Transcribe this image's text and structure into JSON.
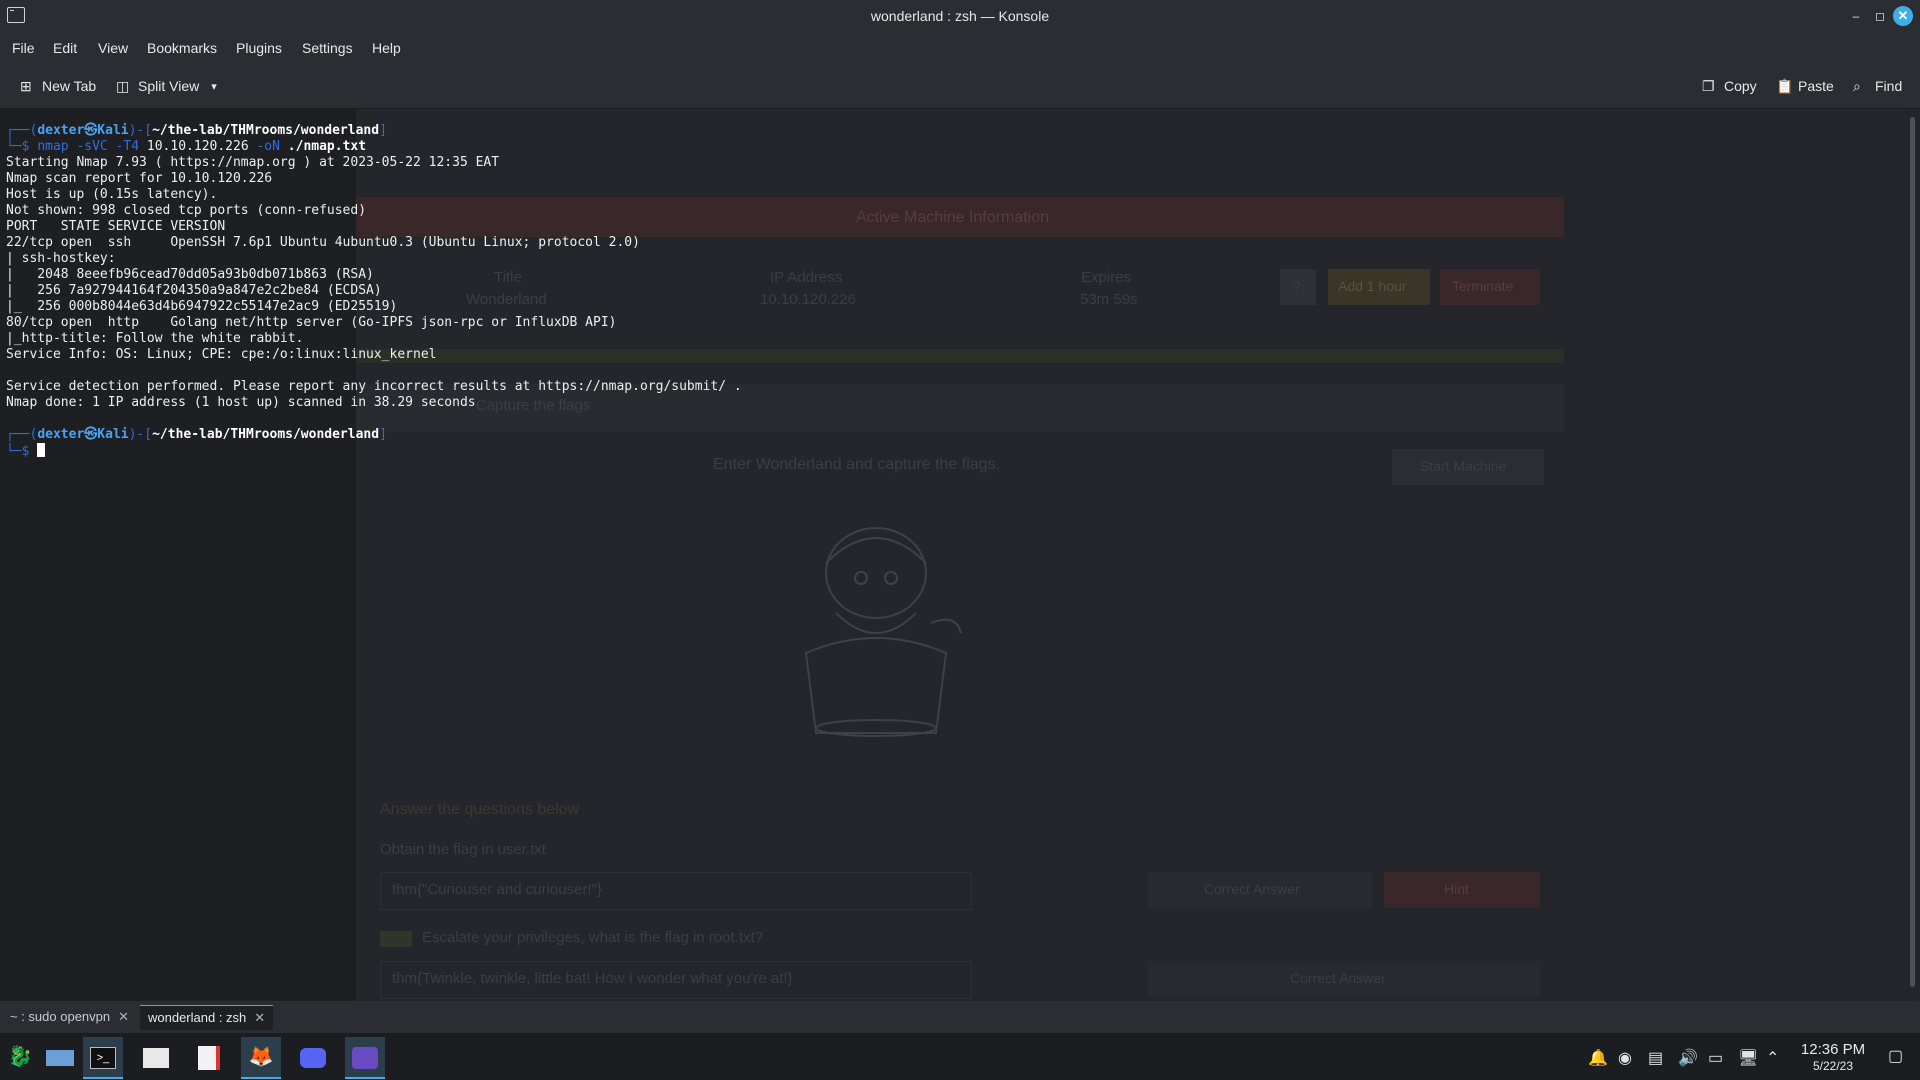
{
  "window": {
    "title": "wonderland : zsh — Konsole"
  },
  "menubar": [
    "File",
    "Edit",
    "View",
    "Bookmarks",
    "Plugins",
    "Settings",
    "Help"
  ],
  "toolbar": {
    "new_tab": "New Tab",
    "split_view": "Split View",
    "copy": "Copy",
    "paste": "Paste",
    "find": "Find"
  },
  "terminal": {
    "prompt1_user": "dexter",
    "prompt1_at": "㉿",
    "prompt1_host": "Kali",
    "prompt1_path": "~/the-lab/THMrooms/wonderland",
    "command": {
      "bin": "nmap",
      "flags": "-sVC -T4",
      "target": "10.10.120.226",
      "oflag": "-oN",
      "file": "./nmap.txt"
    },
    "output": [
      "Starting Nmap 7.93 ( https://nmap.org ) at 2023-05-22 12:35 EAT",
      "Nmap scan report for 10.10.120.226",
      "Host is up (0.15s latency).",
      "Not shown: 998 closed tcp ports (conn-refused)",
      "PORT   STATE SERVICE VERSION",
      "22/tcp open  ssh     OpenSSH 7.6p1 Ubuntu 4ubuntu0.3 (Ubuntu Linux; protocol 2.0)",
      "| ssh-hostkey: ",
      "|   2048 8eeefb96cead70dd05a93b0db071b863 (RSA)",
      "|   256 7a927944164f204350a9a847e2c2be84 (ECDSA)",
      "|_  256 000b8044e63d4b6947922c55147e2ac9 (ED25519)",
      "80/tcp open  http    Golang net/http server (Go-IPFS json-rpc or InfluxDB API)",
      "|_http-title: Follow the white rabbit.",
      "Service Info: OS: Linux; CPE: cpe:/o:linux:linux_kernel",
      "",
      "Service detection performed. Please report any incorrect results at https://nmap.org/submit/ .",
      "Nmap done: 1 IP address (1 host up) scanned in 38.29 seconds"
    ]
  },
  "background_page": {
    "header": "Active Machine Information",
    "col_title": "Title",
    "col_ip": "IP Address",
    "col_expires": "Expires",
    "title_value": "Wonderland",
    "ip_value": "10.10.120.226",
    "expires_value": "53m 59s",
    "help_btn": "?",
    "add_hour": "Add 1 hour",
    "terminate": "Terminate",
    "task_title": "Capture the flags",
    "intro": "Enter Wonderland and capture the flags.",
    "start_machine": "Start Machine",
    "answer_heading": "Answer the questions below",
    "q1": "Obtain the flag in user.txt",
    "a1": "thm{\"Curiouser and curiouser!\"}",
    "correct_answer": "Correct Answer",
    "hint": "Hint",
    "q2": "Escalate your privileges, what is the flag in root.txt?",
    "a2": "thm{Twinkle, twinkle, little bat! How I wonder what you're at!}",
    "correct_answer2": "Correct Answer"
  },
  "tabs": [
    {
      "label": "~ : sudo openvpn"
    },
    {
      "label": "wonderland : zsh"
    }
  ],
  "taskbar": {
    "time": "12:36 PM",
    "date": "5/22/23"
  },
  "colors": {
    "accent": "#3daee9",
    "prompt_blue": "#2f6ee0",
    "terminal_bg": "#1d1f23"
  }
}
